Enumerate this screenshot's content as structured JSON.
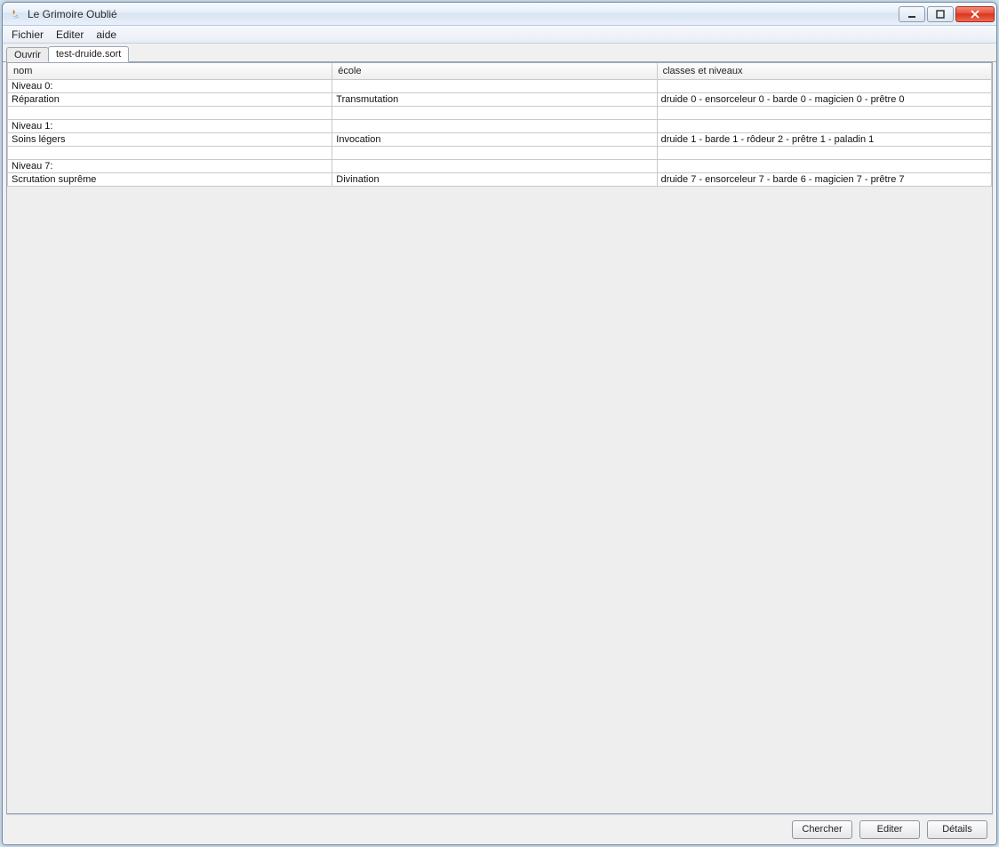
{
  "window": {
    "title": "Le Grimoire Oublié"
  },
  "menu": {
    "file": "Fichier",
    "edit": "Editer",
    "help": "aide"
  },
  "tabs": {
    "open": "Ouvrir",
    "file": "test-druide.sort"
  },
  "table": {
    "headers": {
      "name": "nom",
      "school": "école",
      "classes": "classes et niveaux"
    },
    "rows": [
      {
        "name": "Niveau 0:",
        "school": "",
        "classes": ""
      },
      {
        "name": "Réparation",
        "school": "Transmutation",
        "classes": "druide 0 - ensorceleur 0 - barde 0 - magicien 0 - prêtre 0"
      },
      {
        "name": "",
        "school": "",
        "classes": ""
      },
      {
        "name": "Niveau 1:",
        "school": "",
        "classes": ""
      },
      {
        "name": "Soins légers",
        "school": "Invocation",
        "classes": "druide 1 - barde 1 - rôdeur 2 - prêtre 1 - paladin 1"
      },
      {
        "name": "",
        "school": "",
        "classes": ""
      },
      {
        "name": "Niveau 7:",
        "school": "",
        "classes": ""
      },
      {
        "name": "Scrutation suprême",
        "school": "Divination",
        "classes": "druide 7 - ensorceleur 7 - barde 6 - magicien 7 - prêtre 7"
      }
    ]
  },
  "footer": {
    "search": "Chercher",
    "edit": "Editer",
    "details": "Détails"
  }
}
